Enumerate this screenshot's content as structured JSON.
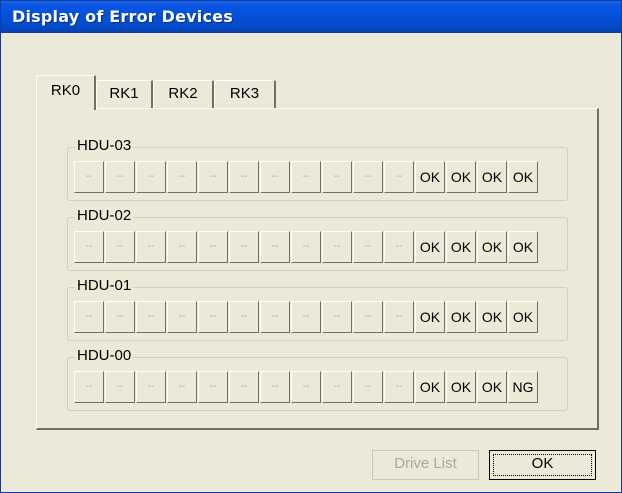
{
  "window": {
    "title": "Display of Error Devices"
  },
  "tabs": [
    {
      "label": "RK0"
    },
    {
      "label": "RK1"
    },
    {
      "label": "RK2"
    },
    {
      "label": "RK3"
    }
  ],
  "active_tab": "RK0",
  "groups": [
    {
      "label": "HDU-03",
      "slots": [
        "--",
        "--",
        "--",
        "--",
        "--",
        "--",
        "--",
        "--",
        "--",
        "--",
        "--",
        "OK",
        "OK",
        "OK",
        "OK"
      ]
    },
    {
      "label": "HDU-02",
      "slots": [
        "--",
        "--",
        "--",
        "--",
        "--",
        "--",
        "--",
        "--",
        "--",
        "--",
        "--",
        "OK",
        "OK",
        "OK",
        "OK"
      ]
    },
    {
      "label": "HDU-01",
      "slots": [
        "--",
        "--",
        "--",
        "--",
        "--",
        "--",
        "--",
        "--",
        "--",
        "--",
        "--",
        "OK",
        "OK",
        "OK",
        "OK"
      ]
    },
    {
      "label": "HDU-00",
      "slots": [
        "--",
        "--",
        "--",
        "--",
        "--",
        "--",
        "--",
        "--",
        "--",
        "--",
        "--",
        "OK",
        "OK",
        "OK",
        "NG"
      ]
    }
  ],
  "buttons": {
    "drive_list": "Drive List",
    "ok": "OK"
  },
  "colors": {
    "title_bar": "#0451d8",
    "dialog_face": "#ece9d8",
    "disabled_text": "#aca899"
  }
}
